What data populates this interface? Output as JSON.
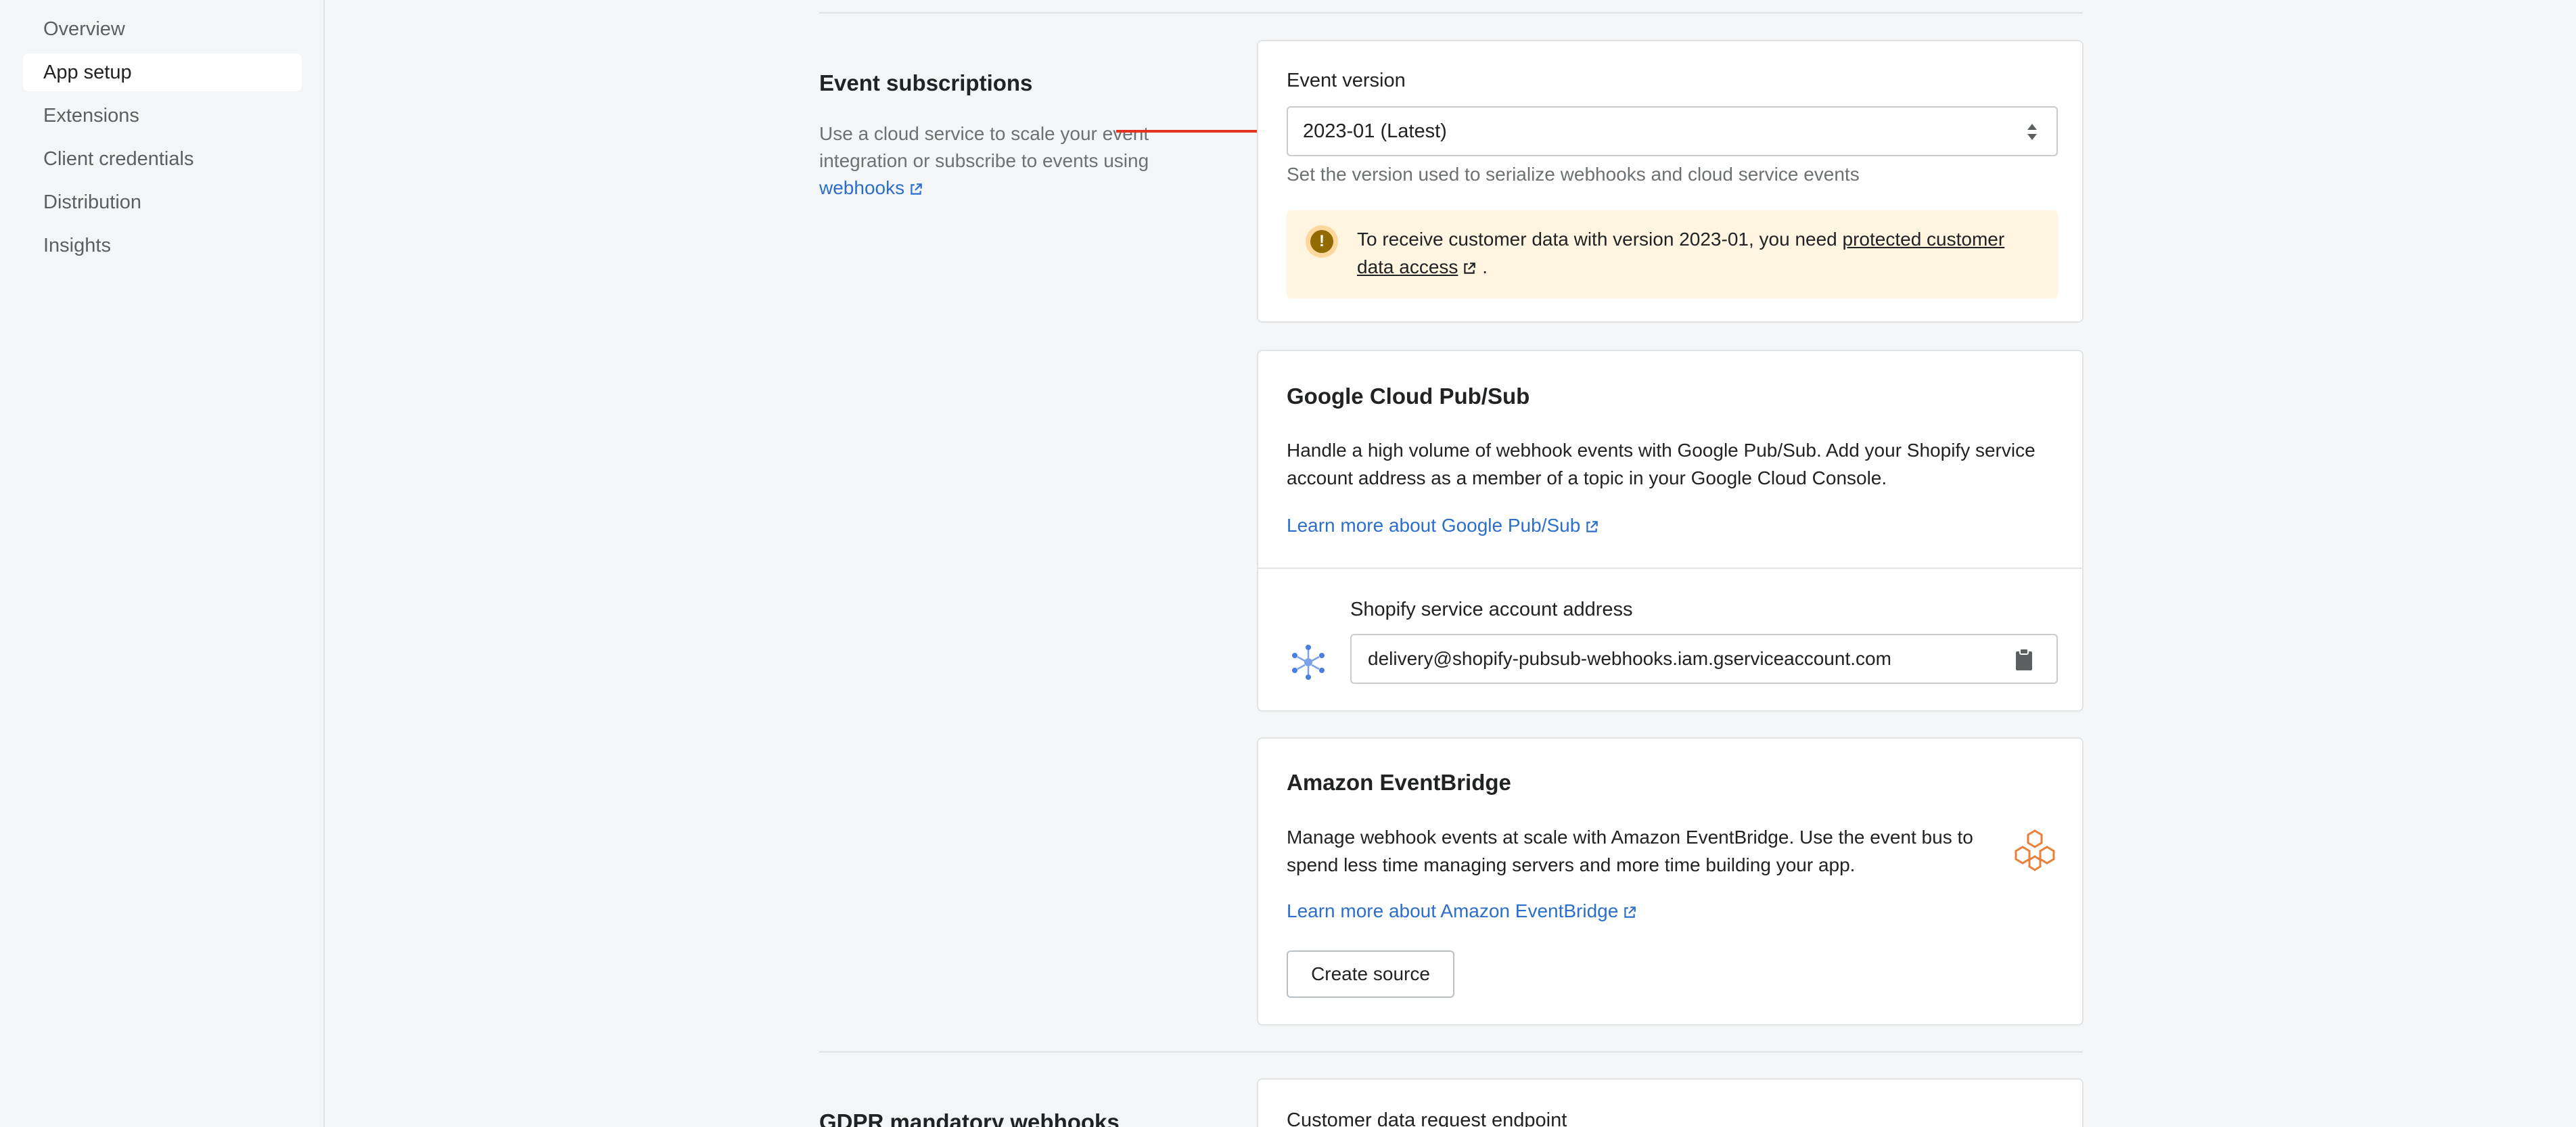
{
  "sidebar": {
    "items": [
      {
        "label": "Overview",
        "active": false
      },
      {
        "label": "App setup",
        "active": true
      },
      {
        "label": "Extensions",
        "active": false
      },
      {
        "label": "Client credentials",
        "active": false
      },
      {
        "label": "Distribution",
        "active": false
      },
      {
        "label": "Insights",
        "active": false
      }
    ]
  },
  "event_subscriptions": {
    "title": "Event subscriptions",
    "description": "Use a cloud service to scale your event integration or subscribe to events using",
    "link": "webhooks"
  },
  "event_version": {
    "label": "Event version",
    "selected": "2023-01 (Latest)",
    "help": "Set the version used to serialize webhooks and cloud service events",
    "banner_text": "To receive customer data with version 2023-01, you need",
    "banner_link": "protected customer data access",
    "banner_end": "."
  },
  "pubsub": {
    "title": "Google Cloud Pub/Sub",
    "body": "Handle a high volume of webhook events with Google Pub/Sub. Add your Shopify service account address as a member of a topic in your Google Cloud Console.",
    "link": "Learn more about Google Pub/Sub",
    "field_label": "Shopify service account address",
    "field_value": "delivery@shopify-pubsub-webhooks.iam.gserviceaccount.com"
  },
  "eventbridge": {
    "title": "Amazon EventBridge",
    "body": "Manage webhook events at scale with Amazon EventBridge. Use the event bus to spend less time managing servers and more time building your app.",
    "link": "Learn more about Amazon EventBridge",
    "button": "Create source"
  },
  "gdpr": {
    "title": "GDPR mandatory webhooks",
    "first_field_label": "Customer data request endpoint"
  },
  "colors": {
    "link": "#2c6ecb",
    "warning_bg": "#fff5e1",
    "annotation_arrow": "#e3321f",
    "eventbridge_icon": "#e8803a"
  }
}
